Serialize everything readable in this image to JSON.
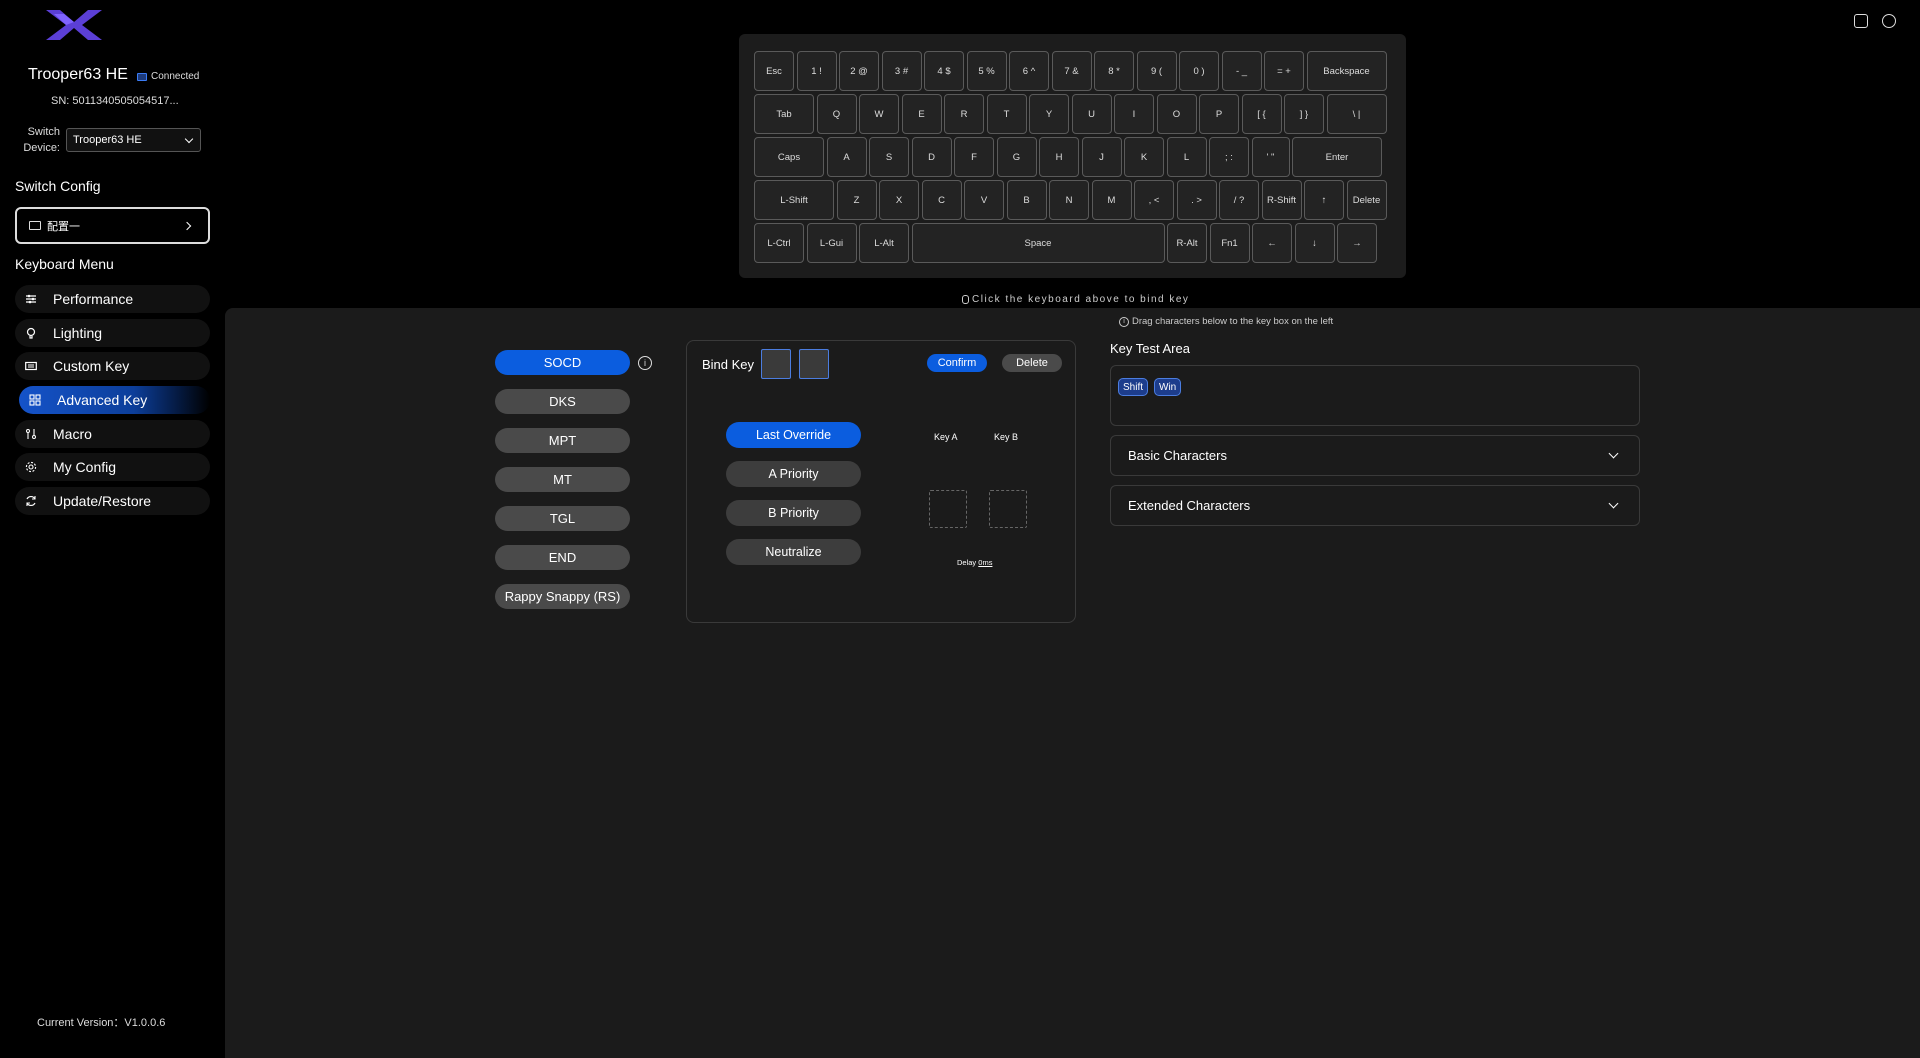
{
  "top_icons": [
    "window-icon",
    "globe-icon"
  ],
  "sidebar": {
    "device_name": "Trooper63 HE",
    "connection_status": "Connected",
    "serial": "SN: 5011340505054517...",
    "switch_device_label": "Switch Device:",
    "switch_device_value": "Trooper63 HE",
    "switch_config_title": "Switch Config",
    "config_name": "配置一",
    "keyboard_menu_title": "Keyboard Menu",
    "menu": [
      {
        "label": "Performance",
        "icon": "sliders-icon"
      },
      {
        "label": "Lighting",
        "icon": "bulb-icon"
      },
      {
        "label": "Custom Key",
        "icon": "keyboard-icon"
      },
      {
        "label": "Advanced Key",
        "icon": "grid-icon",
        "active": true
      },
      {
        "label": "Macro",
        "icon": "macro-icon"
      },
      {
        "label": "My Config",
        "icon": "gear-icon"
      },
      {
        "label": "Update/Restore",
        "icon": "refresh-icon"
      }
    ],
    "version": "Current Version：V1.0.0.6"
  },
  "keyboard": {
    "rows": [
      [
        "Esc",
        "1 !",
        "2 @",
        "3 #",
        "4 $",
        "5 %",
        "6 ^",
        "7 &",
        "8 *",
        "9 (",
        "0 )",
        "- _",
        "= +",
        "Backspace"
      ],
      [
        "Tab",
        "Q",
        "W",
        "E",
        "R",
        "T",
        "Y",
        "U",
        "I",
        "O",
        "P",
        "[ {",
        "] }",
        "\\ |"
      ],
      [
        "Caps",
        "A",
        "S",
        "D",
        "F",
        "G",
        "H",
        "J",
        "K",
        "L",
        "; :",
        "' \"",
        "Enter"
      ],
      [
        "L-Shift",
        "Z",
        "X",
        "C",
        "V",
        "B",
        "N",
        "M",
        ", <",
        ". >",
        "/ ?",
        "R-Shift",
        "↑",
        "Delete"
      ],
      [
        "L-Ctrl",
        "L-Gui",
        "L-Alt",
        "Space",
        "R-Alt",
        "Fn1",
        "←",
        "↓",
        "→"
      ]
    ],
    "hint": "Click the keyboard above to bind key"
  },
  "advanced": {
    "modes": [
      {
        "label": "SOCD",
        "active": true
      },
      {
        "label": "DKS"
      },
      {
        "label": "MPT"
      },
      {
        "label": "MT"
      },
      {
        "label": "TGL"
      },
      {
        "label": "END"
      },
      {
        "label": "Rappy Snappy (RS)"
      }
    ],
    "info_glyph": "i",
    "bind_key_label": "Bind Key",
    "confirm_label": "Confirm",
    "delete_label": "Delete",
    "priorities": [
      {
        "label": "Last Override",
        "active": true
      },
      {
        "label": "A Priority"
      },
      {
        "label": "B Priority"
      },
      {
        "label": "Neutralize"
      }
    ],
    "key_a_label": "Key A",
    "key_b_label": "Key B",
    "delay_label": "Delay",
    "delay_value": "0ms"
  },
  "key_test": {
    "drag_hint": "Drag characters below to the key box on the left",
    "title": "Key Test Area",
    "chips": [
      "Shift",
      "Win"
    ],
    "sections": [
      "Basic Characters",
      "Extended Characters"
    ]
  },
  "colors": {
    "accent": "#0b5ddf",
    "background": "#000000",
    "panel": "#1b1b1b"
  }
}
